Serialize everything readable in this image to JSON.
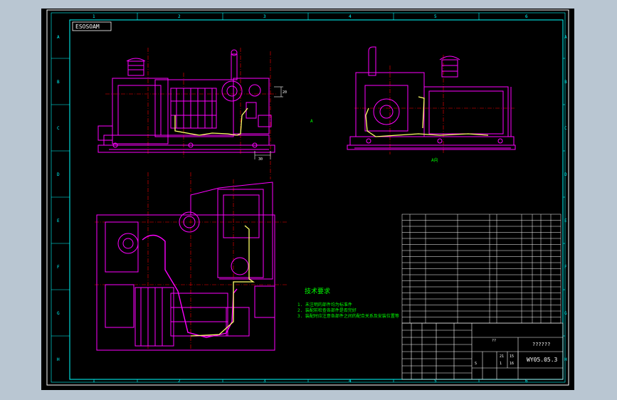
{
  "drawing": {
    "top_left_code": "ESOSOAM",
    "view_label_a": "A",
    "view_label_a_dir": "A向",
    "dimension_1": "20",
    "dimension_2": "30",
    "border_top": [
      "1",
      "2",
      "3",
      "4",
      "5",
      "6"
    ],
    "border_side": [
      "A",
      "B",
      "C",
      "D",
      "E",
      "F",
      "G",
      "H"
    ]
  },
  "notes": {
    "title": "技术要求",
    "lines": [
      "1. 未注明的部件均为标准件",
      "2. 装配前检查各部件是否完好",
      "3. 装配时应注意各部件之间的配合关系及安装位置等"
    ]
  },
  "title_block": {
    "name": "??????",
    "drawing_no": "WY05.05.3",
    "scale_label": "??",
    "sheet_marks": [
      "S",
      "1",
      "16",
      "21",
      "15"
    ]
  },
  "colors": {
    "background": "#000000",
    "frame": "#00ffff",
    "outer_border": "#ffffff",
    "part_lines": "#ff00ff",
    "pipe": "#ffff66",
    "center_lines": "#ff0000",
    "text": "#ffffff",
    "notes_text": "#00ff00"
  }
}
